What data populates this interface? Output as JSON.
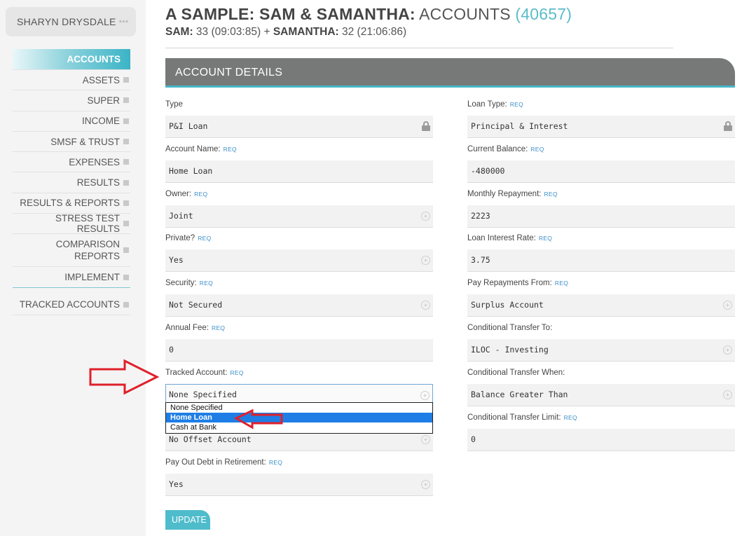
{
  "user": {
    "name": "SHARYN DRYSDALE",
    "stars": "***"
  },
  "nav": {
    "items": [
      {
        "label": "ACCOUNTS"
      },
      {
        "label": "ASSETS"
      },
      {
        "label": "SUPER"
      },
      {
        "label": "INCOME"
      },
      {
        "label": "SMSF & TRUST"
      },
      {
        "label": "EXPENSES"
      },
      {
        "label": "RESULTS"
      },
      {
        "label": "RESULTS & REPORTS"
      },
      {
        "label": "STRESS TEST RESULTS"
      },
      {
        "label": "COMPARISON REPORTS"
      },
      {
        "label": "IMPLEMENT"
      },
      {
        "label": "TRACKED ACCOUNTS"
      }
    ]
  },
  "header": {
    "title_bold": "A SAMPLE: SAM & SAMANTHA:",
    "title_rest": "ACCOUNTS",
    "title_count": "(40657)",
    "person1_label": "SAM:",
    "person1_value": "33 (09:03:85)",
    "plus": "+",
    "person2_label": "SAMANTHA:",
    "person2_value": "32 (21:06:86)"
  },
  "panel": {
    "title": "ACCOUNT DETAILS",
    "req_tag": "REQ"
  },
  "left_fields": [
    {
      "label": "Type",
      "req": false,
      "value": "P&I Loan",
      "icon": "lock-icon"
    },
    {
      "label": "Account Name:",
      "req": true,
      "value": "Home Loan",
      "icon": ""
    },
    {
      "label": "Owner:",
      "req": true,
      "value": "Joint",
      "icon": "plus-circle-icon"
    },
    {
      "label": "Private?",
      "req": true,
      "value": "Yes",
      "icon": "plus-circle-icon"
    },
    {
      "label": "Security:",
      "req": true,
      "value": "Not Secured",
      "icon": "plus-circle-icon"
    },
    {
      "label": "Annual Fee:",
      "req": true,
      "value": "0",
      "icon": ""
    },
    {
      "label": "Tracked Account:",
      "req": true,
      "value": "None Specified",
      "icon": "plus-circle-icon"
    },
    {
      "label": "",
      "req": false,
      "value": "No Offset Account",
      "icon": "plus-circle-icon"
    },
    {
      "label": "Pay Out Debt in Retirement:",
      "req": true,
      "value": "Yes",
      "icon": "plus-circle-icon"
    }
  ],
  "right_fields": [
    {
      "label": "Loan Type:",
      "req": true,
      "value": "Principal & Interest",
      "icon": "lock-icon"
    },
    {
      "label": "Current Balance:",
      "req": true,
      "value": "-480000",
      "icon": ""
    },
    {
      "label": "Monthly Repayment:",
      "req": true,
      "value": "2223",
      "icon": ""
    },
    {
      "label": "Loan Interest Rate:",
      "req": true,
      "value": "3.75",
      "icon": ""
    },
    {
      "label": "Pay Repayments From:",
      "req": true,
      "value": "Surplus Account",
      "icon": "plus-circle-icon"
    },
    {
      "label": "Conditional Transfer To:",
      "req": false,
      "value": "ILOC - Investing",
      "icon": "plus-circle-icon"
    },
    {
      "label": "Conditional Transfer When:",
      "req": false,
      "value": "Balance Greater Than",
      "icon": "plus-circle-icon"
    },
    {
      "label": "Conditional Transfer Limit:",
      "req": true,
      "value": "0",
      "icon": ""
    }
  ],
  "dropdown": {
    "options": [
      "None Specified",
      "Home Loan",
      "Cash at Bank"
    ],
    "selected": "Home Loan"
  },
  "update_button": {
    "label": "UPDATE"
  },
  "colors": {
    "accent": "#47b7c8",
    "banner": "#777878",
    "selected_option": "#1f7ee6",
    "annotation_arrow": "#e0202a"
  }
}
